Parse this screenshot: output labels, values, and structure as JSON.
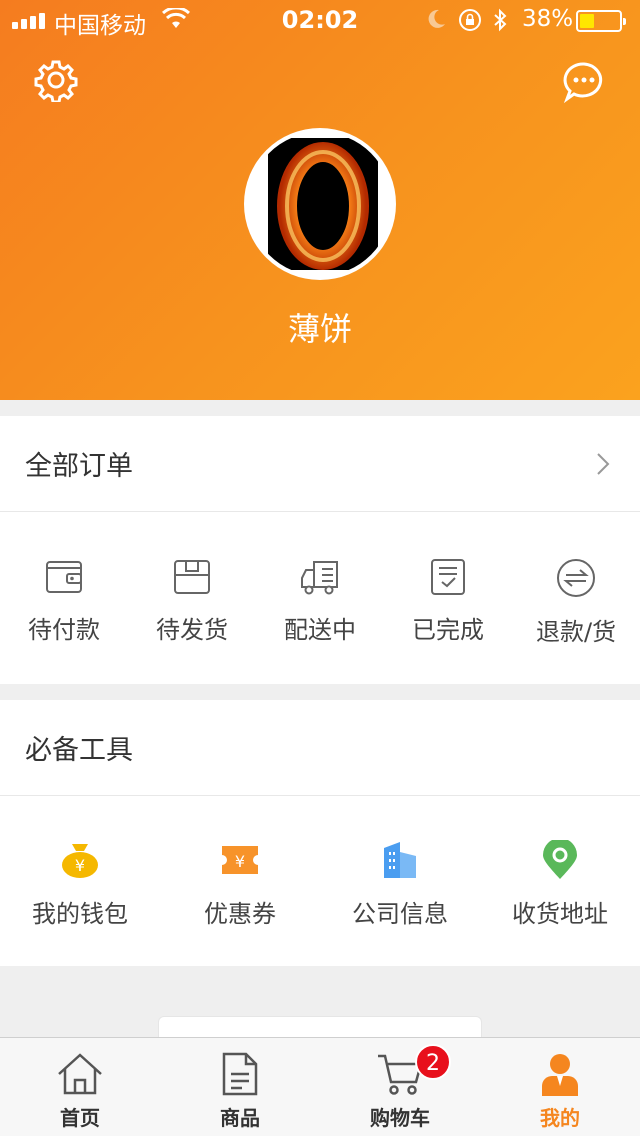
{
  "status_bar": {
    "carrier": "中国移动",
    "time": "02:02",
    "battery": "38%",
    "battery_level": 0.38
  },
  "header": {
    "settings_icon": "gear-icon",
    "message_icon": "chat-bubble-icon",
    "username": "薄饼"
  },
  "orders": {
    "title": "全部订单",
    "items": [
      {
        "label": "待付款",
        "icon": "wallet-icon"
      },
      {
        "label": "待发货",
        "icon": "box-icon"
      },
      {
        "label": "配送中",
        "icon": "truck-icon"
      },
      {
        "label": "已完成",
        "icon": "check-doc-icon"
      },
      {
        "label": "退款/货",
        "icon": "exchange-icon"
      }
    ]
  },
  "tools": {
    "title": "必备工具",
    "items": [
      {
        "label": "我的钱包",
        "icon": "money-bag-icon",
        "color": "#f5b800"
      },
      {
        "label": "优惠券",
        "icon": "coupon-icon",
        "color": "#f7932a"
      },
      {
        "label": "公司信息",
        "icon": "building-icon",
        "color": "#4a9df0"
      },
      {
        "label": "收货地址",
        "icon": "location-pin-icon",
        "color": "#5ab85a"
      }
    ]
  },
  "tabbar": {
    "tabs": [
      {
        "label": "首页",
        "icon": "home-icon"
      },
      {
        "label": "商品",
        "icon": "document-icon"
      },
      {
        "label": "购物车",
        "icon": "cart-icon",
        "badge": "2"
      },
      {
        "label": "我的",
        "icon": "user-icon",
        "active": true
      }
    ]
  },
  "colors": {
    "accent": "#f7931e",
    "badge": "#e8101c"
  }
}
